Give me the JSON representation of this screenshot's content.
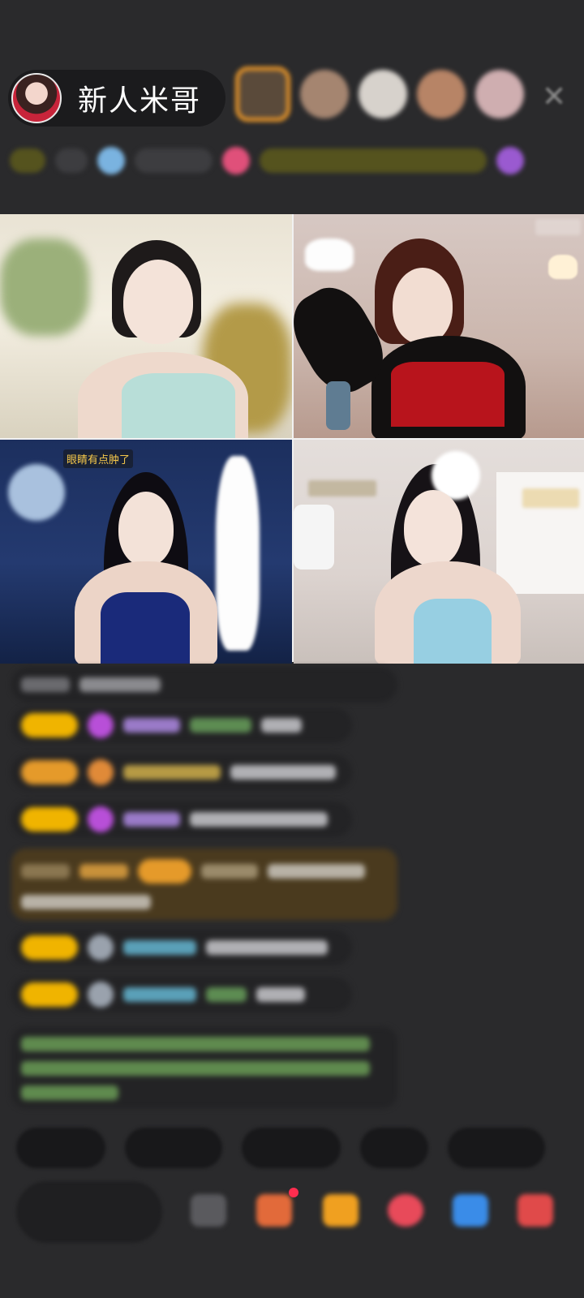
{
  "host": {
    "name": "新人米哥"
  },
  "tiles": [
    {
      "label": ""
    },
    {
      "label": ""
    },
    {
      "label": "眼睛有点肿了"
    },
    {
      "label": ""
    }
  ],
  "colors": {
    "background": "#2a2a2c",
    "badge_gold": "#f0b400",
    "gift_highlight": "#e6952a"
  }
}
